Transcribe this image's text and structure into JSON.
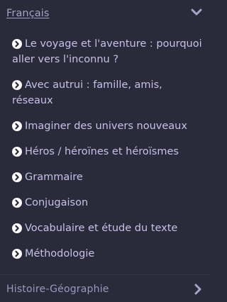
{
  "section": {
    "title": "Français",
    "expand_icon": "chevron-down-icon"
  },
  "items": [
    {
      "label": "Le voyage et l'aventure : pourquoi aller vers l'inconnu ?",
      "icon": "chevron-circle-right-icon"
    },
    {
      "label": "Avec autrui : famille, amis, réseaux",
      "icon": "chevron-circle-right-icon"
    },
    {
      "label": "Imaginer des univers nouveaux",
      "icon": "chevron-circle-right-icon"
    },
    {
      "label": "Héros / héroïnes et héroïsmes",
      "icon": "chevron-circle-right-icon"
    },
    {
      "label": "Grammaire",
      "icon": "chevron-circle-right-icon"
    },
    {
      "label": "Conjugaison",
      "icon": "chevron-circle-right-icon"
    },
    {
      "label": "Vocabulaire et étude du texte",
      "icon": "chevron-circle-right-icon"
    },
    {
      "label": "Méthodologie",
      "icon": "chevron-circle-right-icon"
    }
  ],
  "next_section": {
    "title": "Histoire-Géographie",
    "icon": "chevron-right-icon"
  },
  "colors": {
    "background": "#2b2a3a",
    "header_text": "#a7a3c9",
    "item_text": "#c7c1ea",
    "bullet": "#ffffff"
  }
}
